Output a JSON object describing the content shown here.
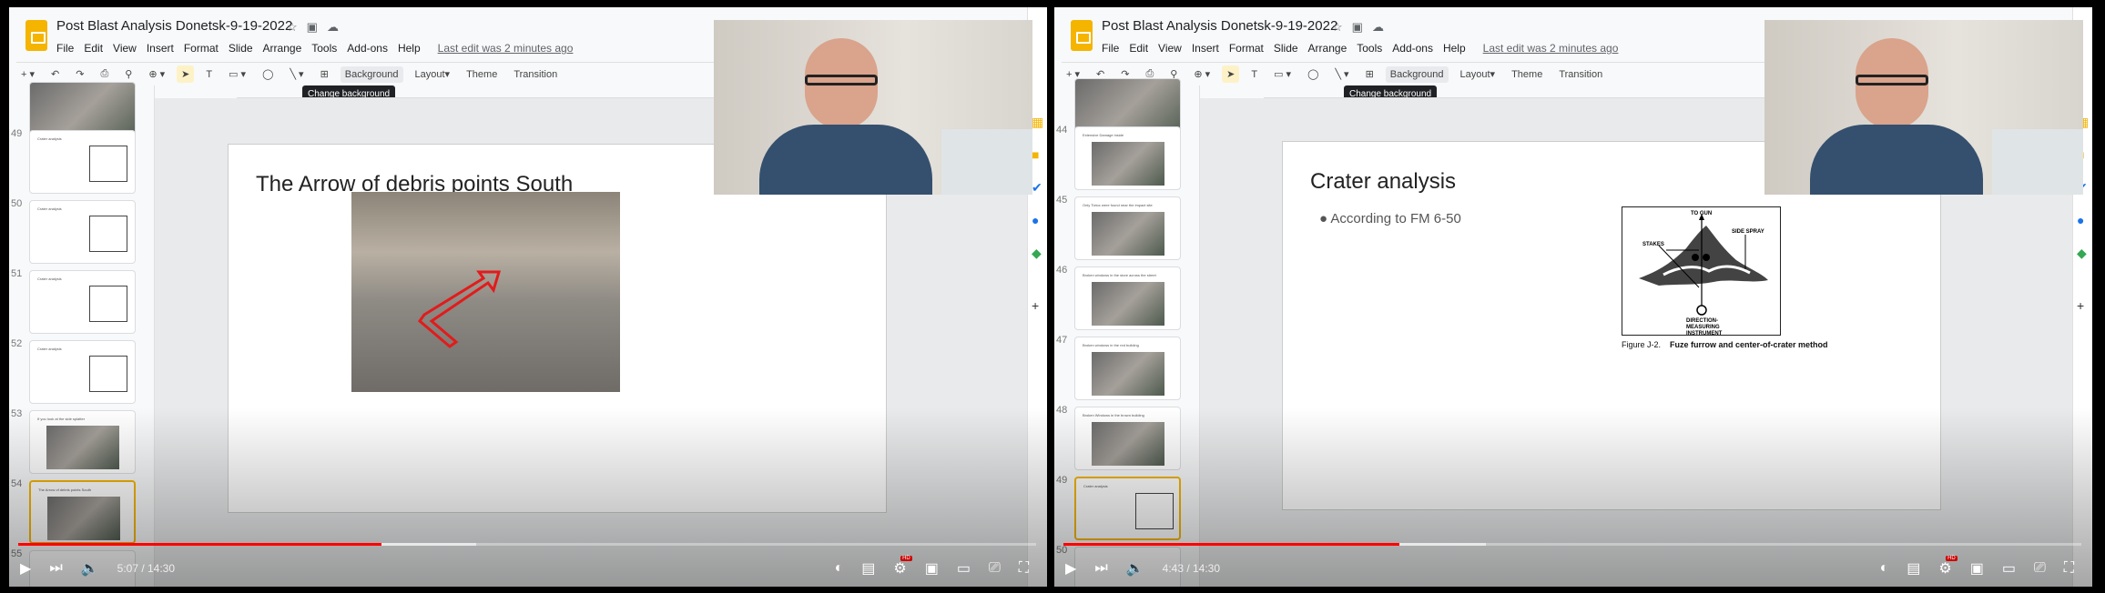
{
  "frames": [
    {
      "app": {
        "title": "Post Blast Analysis Donetsk-9-19-2022",
        "menu": [
          "File",
          "Edit",
          "View",
          "Insert",
          "Format",
          "Slide",
          "Arrange",
          "Tools",
          "Add-ons",
          "Help"
        ],
        "last_edit": "Last edit was 2 minutes ago"
      },
      "toolbar": {
        "background": "Background",
        "layout": "Layout▾",
        "theme": "Theme",
        "transition": "Transition",
        "tooltip": "Change background"
      },
      "thumbnails": [
        {
          "num": "",
          "title": "",
          "kind": "photo"
        },
        {
          "num": "49",
          "title": "Crater analysis",
          "kind": "figure"
        },
        {
          "num": "50",
          "title": "Crater analysis",
          "kind": "figure"
        },
        {
          "num": "51",
          "title": "Crater analysis",
          "kind": "figure"
        },
        {
          "num": "52",
          "title": "Crater analysis",
          "kind": "figure"
        },
        {
          "num": "53",
          "title": "If you look at the side splatter",
          "kind": "photo"
        },
        {
          "num": "54",
          "title": "The Arrow of debris points South",
          "kind": "photo",
          "active": true
        },
        {
          "num": "55",
          "title": "",
          "kind": "blank"
        }
      ],
      "slide": {
        "type": "photo",
        "title": "The Arrow of debris points South"
      },
      "player": {
        "time": "5:07 / 14:30",
        "played_fraction": 0.357,
        "buffered_fraction": 0.45,
        "hd_badge": "HD"
      }
    },
    {
      "app": {
        "title": "Post Blast Analysis Donetsk-9-19-2022",
        "menu": [
          "File",
          "Edit",
          "View",
          "Insert",
          "Format",
          "Slide",
          "Arrange",
          "Tools",
          "Add-ons",
          "Help"
        ],
        "last_edit": "Last edit was 2 minutes ago"
      },
      "toolbar": {
        "background": "Background",
        "layout": "Layout▾",
        "theme": "Theme",
        "transition": "Transition",
        "tooltip": "Change background"
      },
      "thumbnails": [
        {
          "num": "",
          "title": "",
          "kind": "photo"
        },
        {
          "num": "44",
          "title": "Extensive Damage inside",
          "kind": "photo"
        },
        {
          "num": "45",
          "title": "Only Tiztoc were found near the impact site",
          "kind": "photo"
        },
        {
          "num": "46",
          "title": "Broken windows in the store across the street",
          "kind": "photo"
        },
        {
          "num": "47",
          "title": "Broken windows in the red building",
          "kind": "photo"
        },
        {
          "num": "48",
          "title": "Broken Windows in the brown building",
          "kind": "photo"
        },
        {
          "num": "49",
          "title": "Crater analysis",
          "kind": "figure",
          "active": true
        },
        {
          "num": "50",
          "title": "",
          "kind": "blank"
        }
      ],
      "slide": {
        "type": "figure",
        "title": "Crater analysis",
        "bullet": "According to FM 6-50",
        "figure": {
          "labels": {
            "to_gun": "TO GUN",
            "side_spray": "SIDE SPRAY",
            "stakes": "STAKES",
            "instrument": [
              "DIRECTION-",
              "MEASURING",
              "INSTRUMENT"
            ]
          },
          "caption_num": "Figure J-2.",
          "caption": "Fuze furrow and center-of-crater method"
        }
      },
      "player": {
        "time": "4:43 / 14:30",
        "played_fraction": 0.33,
        "buffered_fraction": 0.415,
        "hd_badge": "HD"
      }
    }
  ],
  "colors": {
    "accent": "#f4b400",
    "progress": "#ff0000"
  }
}
